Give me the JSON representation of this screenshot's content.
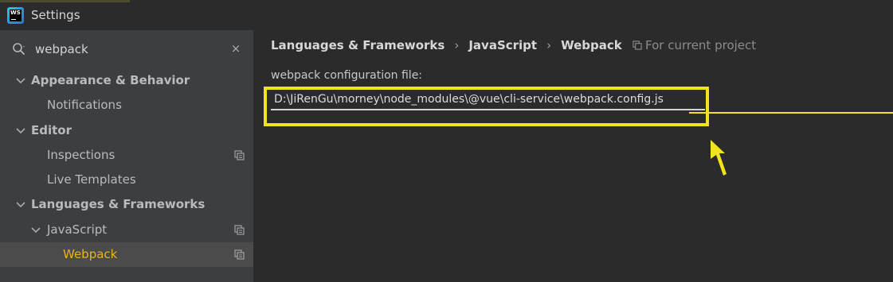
{
  "window": {
    "title": "Settings",
    "logo_text": "WS"
  },
  "colors": {
    "selected_text": "#e6b422",
    "highlight": "#f1e41e",
    "sidebar_bg": "#3c3f41"
  },
  "sidebar": {
    "search": {
      "value": "webpack",
      "clear_label": "×",
      "icon": "search-icon"
    },
    "items": [
      {
        "label": "Appearance & Behavior",
        "expanded": true,
        "bold": true
      },
      {
        "label": "Notifications"
      },
      {
        "label": "Editor",
        "expanded": true,
        "bold": true
      },
      {
        "label": "Inspections",
        "icon": "copy-icon"
      },
      {
        "label": "Live Templates"
      },
      {
        "label": "Languages & Frameworks",
        "expanded": true,
        "bold": true
      },
      {
        "label": "JavaScript",
        "expanded": true,
        "icon": "copy-icon"
      },
      {
        "label": "Webpack",
        "selected": true,
        "icon": "copy-icon"
      }
    ]
  },
  "main": {
    "breadcrumb": [
      "Languages & Frameworks",
      "JavaScript",
      "Webpack"
    ],
    "breadcrumb_sep": "›",
    "scope_label": "For current project",
    "config_label": "webpack configuration file:",
    "config_value": "D:\\JiRenGu\\morney\\node_modules\\@vue\\cli-service\\webpack.config.js"
  }
}
